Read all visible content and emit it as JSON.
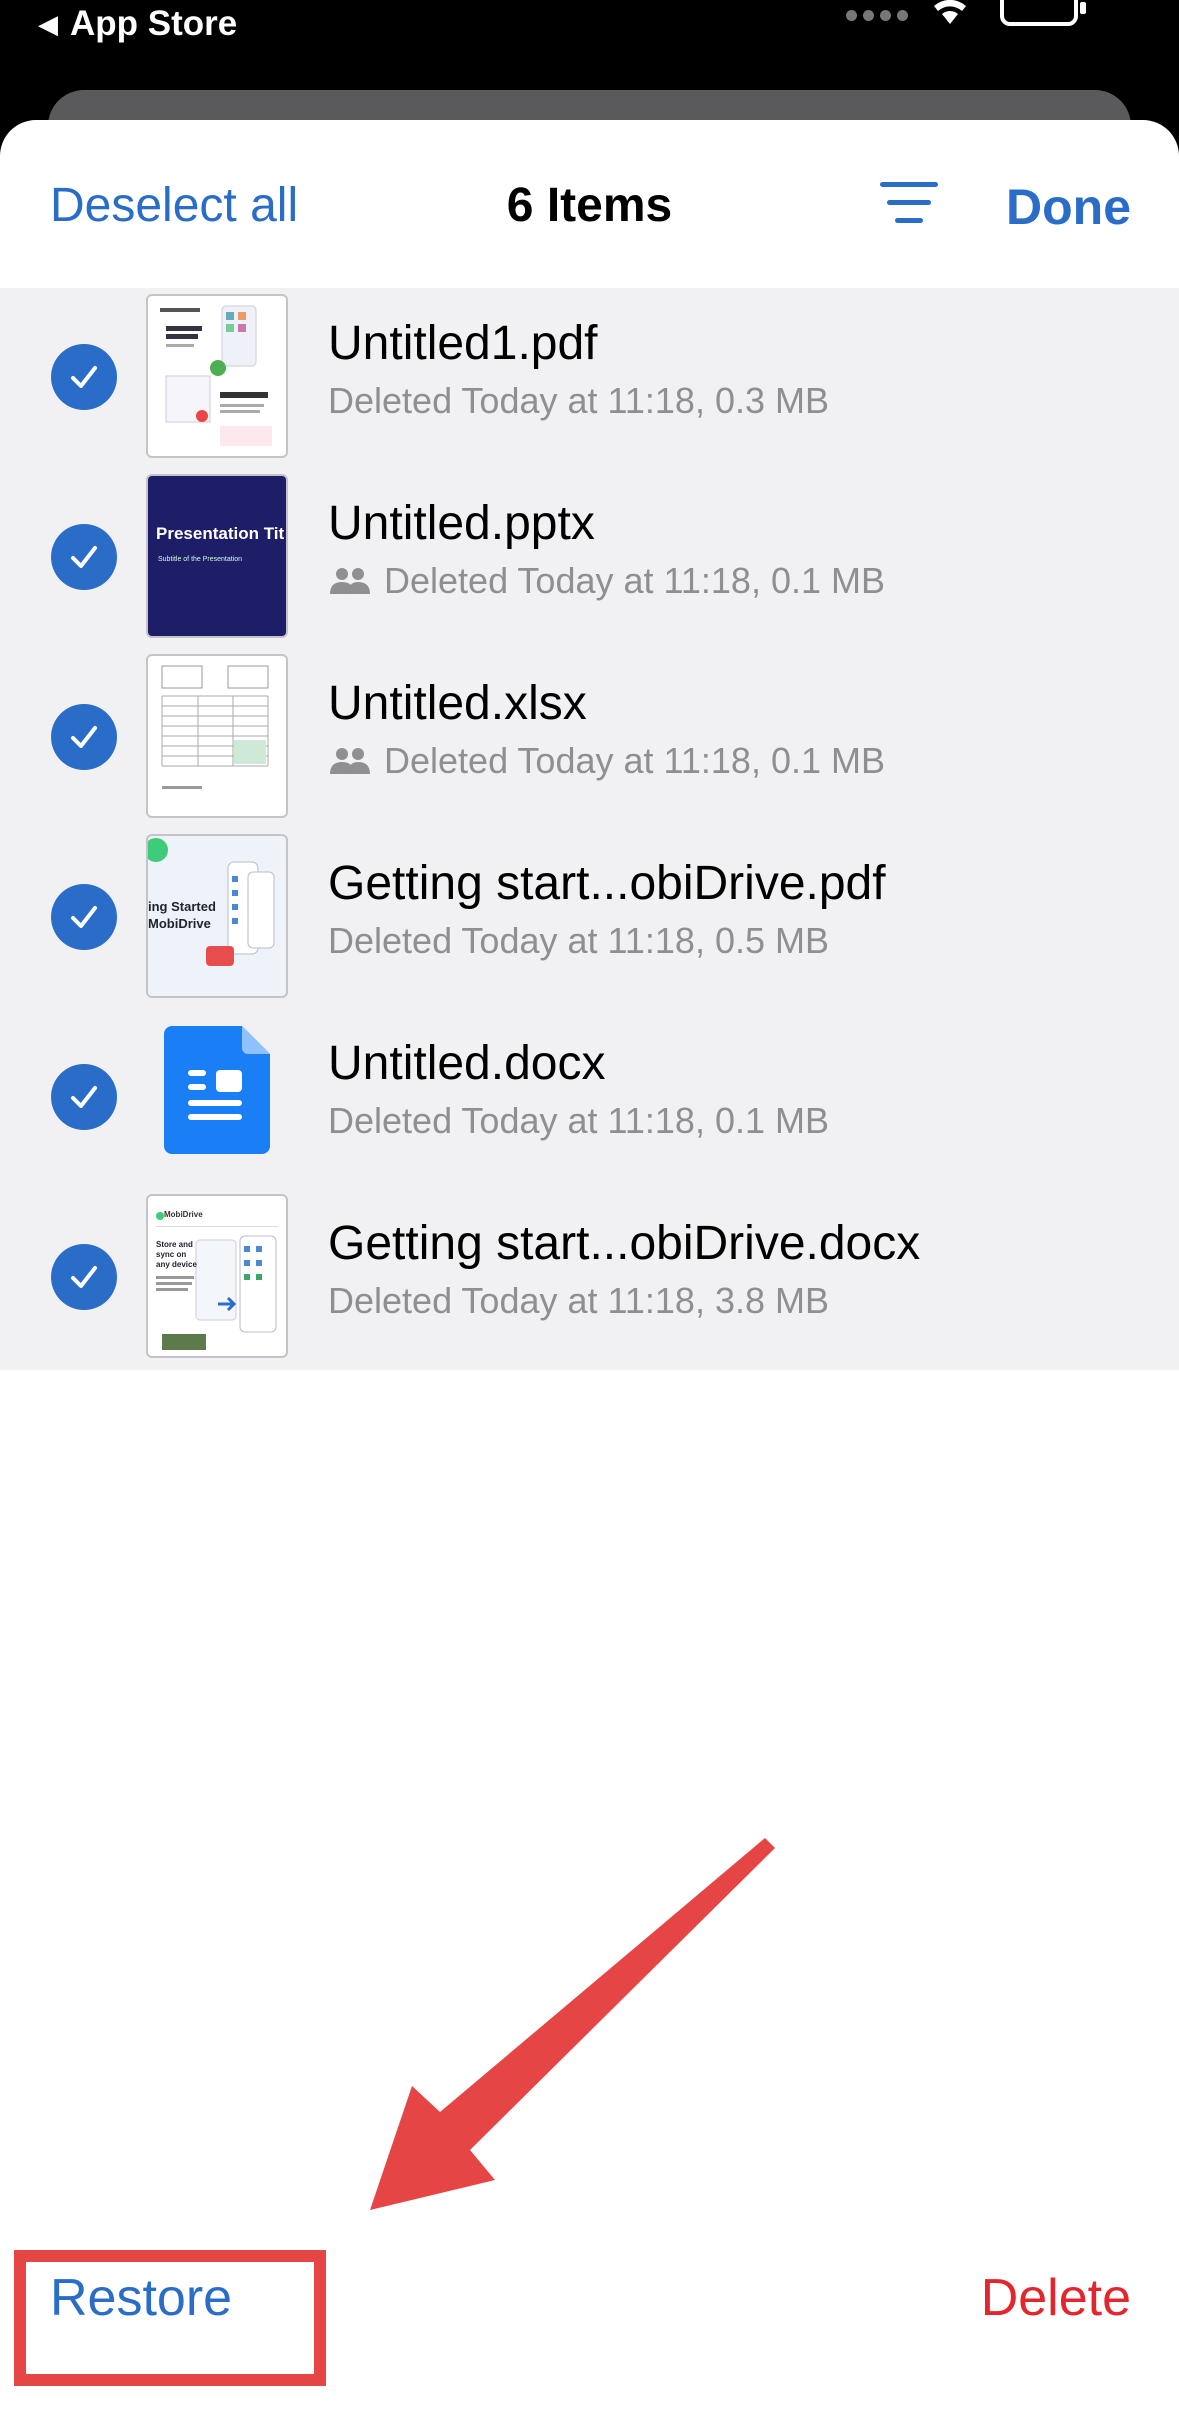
{
  "status_bar": {
    "back_app_label": "App Store"
  },
  "nav": {
    "deselect_label": "Deselect all",
    "title": "6 Items",
    "done_label": "Done"
  },
  "items": [
    {
      "name": "Untitled1.pdf",
      "meta": "Deleted Today at 11:18, 0.3 MB",
      "shared": false,
      "thumb": "pdf-preview"
    },
    {
      "name": "Untitled.pptx",
      "meta": "Deleted Today at 11:18, 0.1 MB",
      "shared": true,
      "thumb": "pptx-preview",
      "thumb_title": "Presentation Tit",
      "thumb_subtitle": "Subtitle of the Presentation"
    },
    {
      "name": "Untitled.xlsx",
      "meta": "Deleted Today at 11:18, 0.1 MB",
      "shared": true,
      "thumb": "xlsx-preview"
    },
    {
      "name": "Getting start...obiDrive.pdf",
      "meta": "Deleted Today at 11:18, 0.5 MB",
      "shared": false,
      "thumb": "pdf-preview",
      "thumb_title": "ing Started MobiDrive"
    },
    {
      "name": "Untitled.docx",
      "meta": "Deleted Today at 11:18, 0.1 MB",
      "shared": false,
      "thumb": "docx-icon"
    },
    {
      "name": "Getting start...obiDrive.docx",
      "meta": "Deleted Today at 11:18, 3.8 MB",
      "shared": false,
      "thumb": "docx-preview",
      "thumb_title": "Store and sync on any device",
      "thumb_brand": "MobiDrive"
    }
  ],
  "toolbar": {
    "restore_label": "Restore",
    "delete_label": "Delete"
  },
  "colors": {
    "accent": "#2a6dc8",
    "destructive": "#e3262c",
    "annotation": "#e64545",
    "list_background": "#f1f1f3"
  }
}
